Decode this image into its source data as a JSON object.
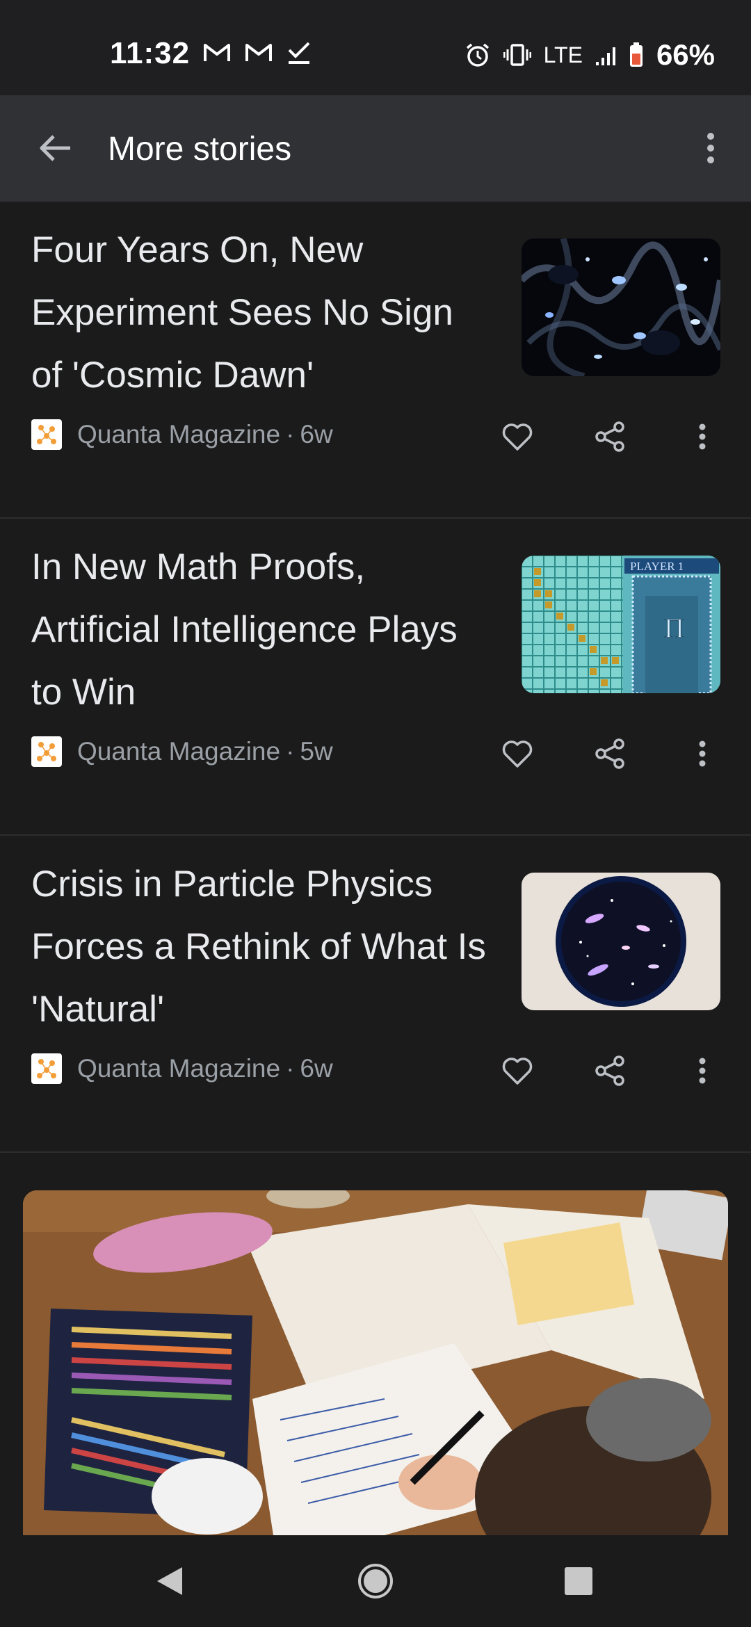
{
  "status_bar": {
    "time": "11:32",
    "left_icons": [
      "gmail-icon",
      "gmail-icon",
      "check-icon"
    ],
    "right_icons": [
      "alarm-icon",
      "vibrate-icon",
      "signal-icon",
      "battery-icon"
    ],
    "network": "LTE",
    "battery": "66%"
  },
  "app_bar": {
    "title": "More stories"
  },
  "stories": [
    {
      "title": "Four Years On, New Experiment Sees No Sign of 'Cosmic Dawn'",
      "source": "Quanta Magazine",
      "age": "6w",
      "thumb": "galaxy-web-thumbnail"
    },
    {
      "title": "In New Math Proofs, Artificial Intelligence Plays to Win",
      "source": "Quanta Magazine",
      "age": "5w",
      "thumb": "game-grid-thumbnail",
      "thumb_text": "PLAYER 1"
    },
    {
      "title": "Crisis in Particle Physics Forces a Rethink of What Is 'Natural'",
      "source": "Quanta Magazine",
      "age": "6w",
      "thumb": "universe-bubble-thumbnail"
    }
  ],
  "big_card": {
    "image": "child-doing-homework-photo"
  },
  "nav": [
    "back-triangle-icon",
    "home-circle-icon",
    "recents-square-icon"
  ],
  "colors": {
    "background": "#1b1b1b",
    "app_bar": "#303134",
    "title_text": "#e8eaed",
    "meta_text": "#9aa0a6",
    "battery_accent": "#f28b66"
  }
}
